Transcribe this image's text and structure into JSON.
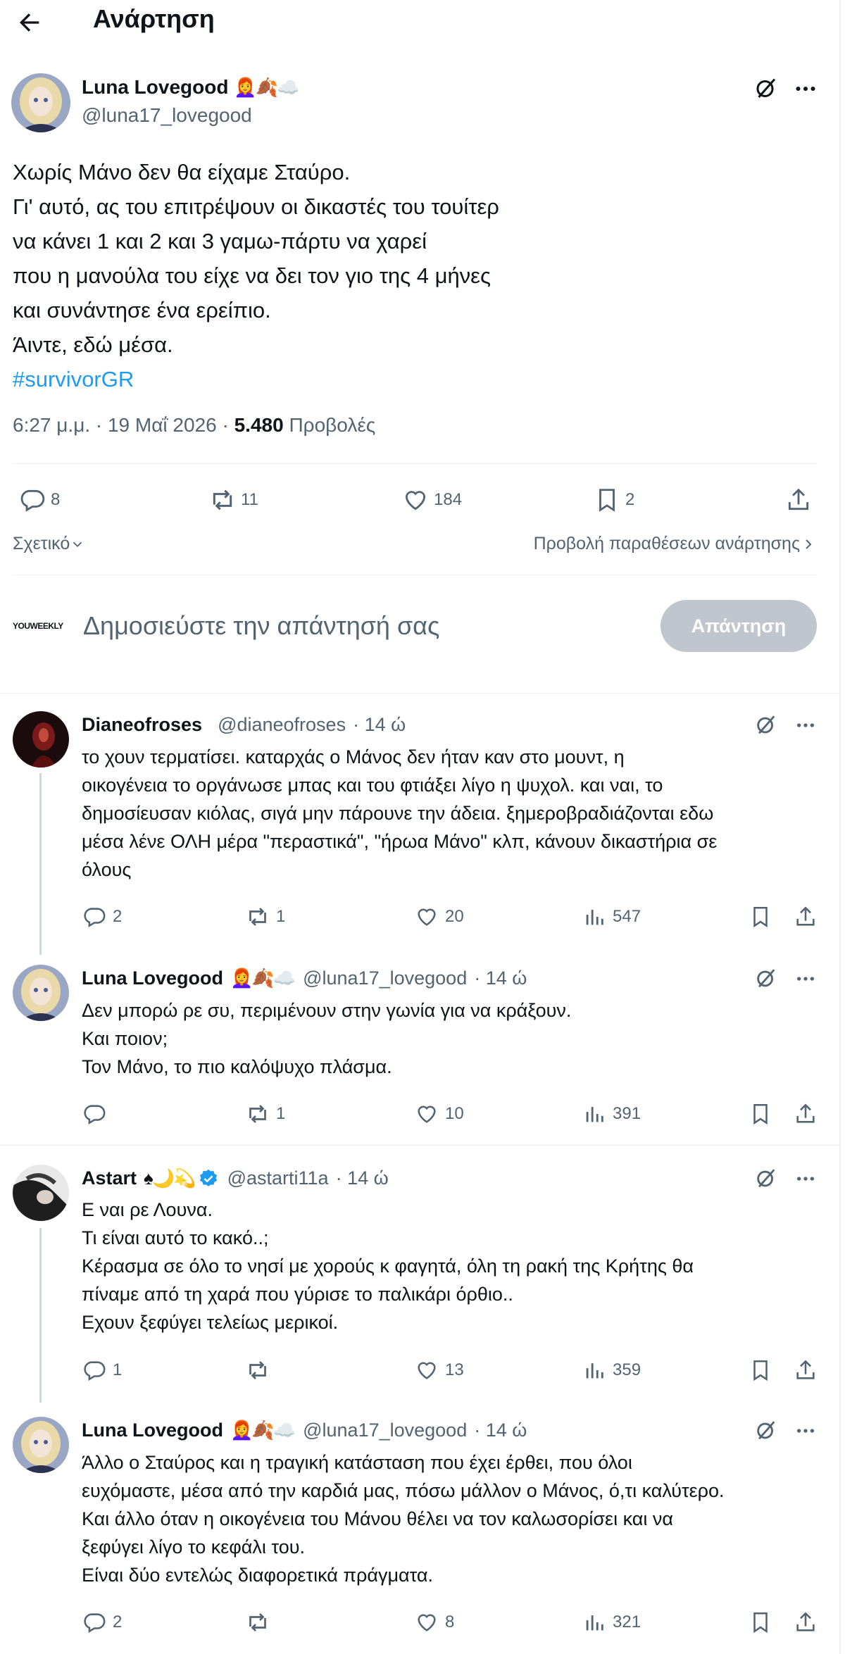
{
  "header": {
    "title": "Ανάρτηση"
  },
  "post": {
    "author": "Luna Lovegood",
    "emoji": "👩‍🦰🍂☁️",
    "handle": "@luna17_lovegood",
    "lines": [
      "Χωρίς Μάνο δεν θα είχαμε Σταύρο.",
      "Γι' αυτό, ας του επιτρέψουν οι δικαστές του τουίτερ",
      "να κάνει 1 και 2 και 3 γαμω-πάρτυ να χαρεί",
      "που η μανούλα του είχε να δει τον γιο της 4 μήνες",
      "και συνάντησε ένα ερείπιο.",
      "Άιντε, εδώ μέσα."
    ],
    "hashtag": "#survivorGR",
    "time": "6:27 μ.μ. · 19 Μαΐ 2026 · ",
    "views": "5.480",
    "views_label": " Προβολές",
    "counts": {
      "replies": "8",
      "reposts": "11",
      "likes": "184",
      "bookmarks": "2"
    },
    "related": "Σχετικό",
    "quotes_link": "Προβολή παραθέσεων ανάρτησης"
  },
  "compose": {
    "avatar_text": "YOUWEEKLY",
    "placeholder": "Δημοσιεύστε την απάντησή σας",
    "button": "Απάντηση"
  },
  "replies": [
    {
      "author": "Dianeofroses",
      "emoji": "",
      "handle": "@dianeofroses",
      "time": "· 14 ώ",
      "lines": [
        "το χουν τερματίσει. καταρχάς ο Μάνος δεν ήταν καν στο μουντ, η",
        "οικογένεια το οργάνωσε μπας και του φτιάξει λίγο η ψυχολ. και ναι, το",
        "δημοσίευσαν κιόλας, σιγά μην πάρουνε την άδεια. ξημεροβραδιάζονται εδω",
        "μέσα λένε ΟΛΗ μέρα \"περαστικά\", \"ήρωα Μάνο\" κλπ, κάνουν δικαστήρια σε",
        "όλους"
      ],
      "replies": "2",
      "reposts": "1",
      "likes": "20",
      "views": "547"
    },
    {
      "author": "Luna Lovegood",
      "emoji": "👩‍🦰🍂☁️",
      "handle": "@luna17_lovegood",
      "time": "· 14 ώ",
      "lines": [
        "Δεν μπορώ ρε συ, περιμένουν στην γωνία για να κράξουν.",
        "Και ποιον;",
        "Τον Μάνο, το πιο καλόψυχο πλάσμα."
      ],
      "replies": "",
      "reposts": "1",
      "likes": "10",
      "views": "391"
    },
    {
      "author": "Astart",
      "emoji": "♠🌙💫",
      "handle": "@astarti11a",
      "time": "· 14 ώ",
      "lines": [
        "Ε ναι ρε Λουνα.",
        "Τι είναι αυτό το κακό..;",
        "Κέρασμα σε όλο το νησί με χορούς κ φαγητά, όλη τη ρακή της Κρήτης θα",
        "πίναμε από τη χαρά που γύρισε το παλικάρι όρθιο..",
        "Εχουν ξεφύγει τελείως μερικοί."
      ],
      "replies": "1",
      "reposts": "",
      "likes": "13",
      "views": "359"
    },
    {
      "author": "Luna Lovegood",
      "emoji": "👩‍🦰🍂☁️",
      "handle": "@luna17_lovegood",
      "time": "· 14 ώ",
      "lines": [
        "Άλλο ο Σταύρος και η τραγική κατάσταση που έχει έρθει, που όλοι",
        "ευχόμαστε, μέσα από την καρδιά μας, πόσω μάλλον ο Μάνος, ό,τι καλύτερο.",
        "Και άλλο όταν η οικογένεια του Μάνου θέλει να τον καλωσορίσει και να",
        "ξεφύγει λίγο το κεφάλι του.",
        "Είναι δύο εντελώς διαφορετικά πράγματα."
      ],
      "replies": "2",
      "reposts": "",
      "likes": "8",
      "views": "321"
    }
  ]
}
